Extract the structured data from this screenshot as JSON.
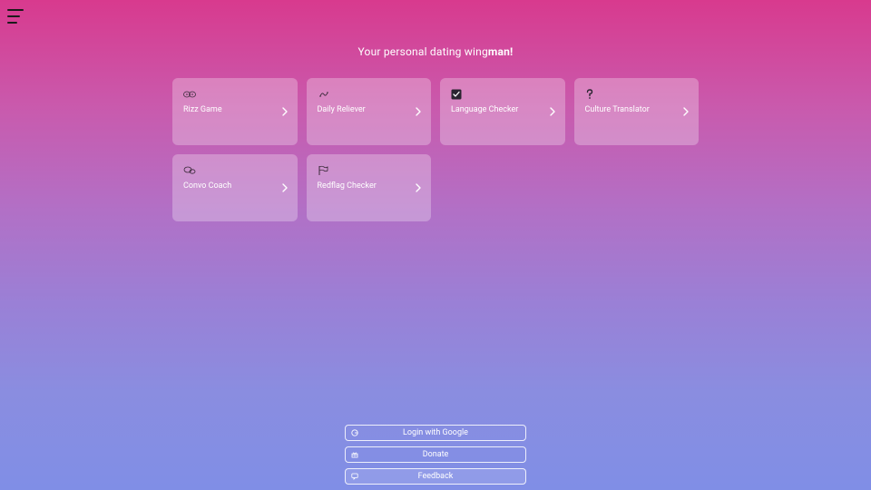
{
  "tagline": {
    "prefix": "Your personal dating wing",
    "bold": "man!"
  },
  "cards": [
    {
      "icon": "game-icon",
      "label": "Rizz Game"
    },
    {
      "icon": "reliever-icon",
      "label": "Daily Reliever"
    },
    {
      "icon": "check-icon",
      "label": "Language Checker"
    },
    {
      "icon": "question-icon",
      "label": "Culture Translator"
    },
    {
      "icon": "coach-icon",
      "label": "Convo Coach"
    },
    {
      "icon": "flag-icon",
      "label": "Redflag Checker"
    }
  ],
  "footer": {
    "login": "Login with Google",
    "donate": "Donate",
    "feedback": "Feedback"
  }
}
